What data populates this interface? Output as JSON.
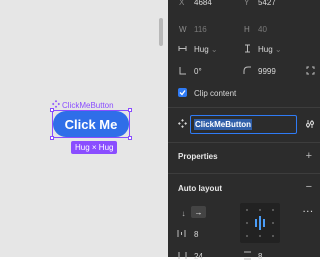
{
  "canvas": {
    "component_name": "ClickMeButton",
    "button_label": "Click Me",
    "size_badge": "Hug × Hug"
  },
  "panel": {
    "x_label": "X",
    "x_value": "4684",
    "y_label": "Y",
    "y_value": "5427",
    "w_label": "W",
    "w_value": "116",
    "h_label": "H",
    "h_value": "40",
    "width_mode": "Hug",
    "height_mode": "Hug",
    "rotation": "0°",
    "corner_radius": "9999",
    "clip_content_label": "Clip content",
    "layer_name": "ClickMeButton",
    "properties_title": "Properties",
    "auto_layout_title": "Auto layout",
    "gap_value": "8",
    "padding_h_value": "24",
    "padding_v_value": "8",
    "colors": {
      "accent": "#2f7bf5",
      "component": "#8a4dff",
      "panel_bg": "#2c2c2c"
    }
  }
}
